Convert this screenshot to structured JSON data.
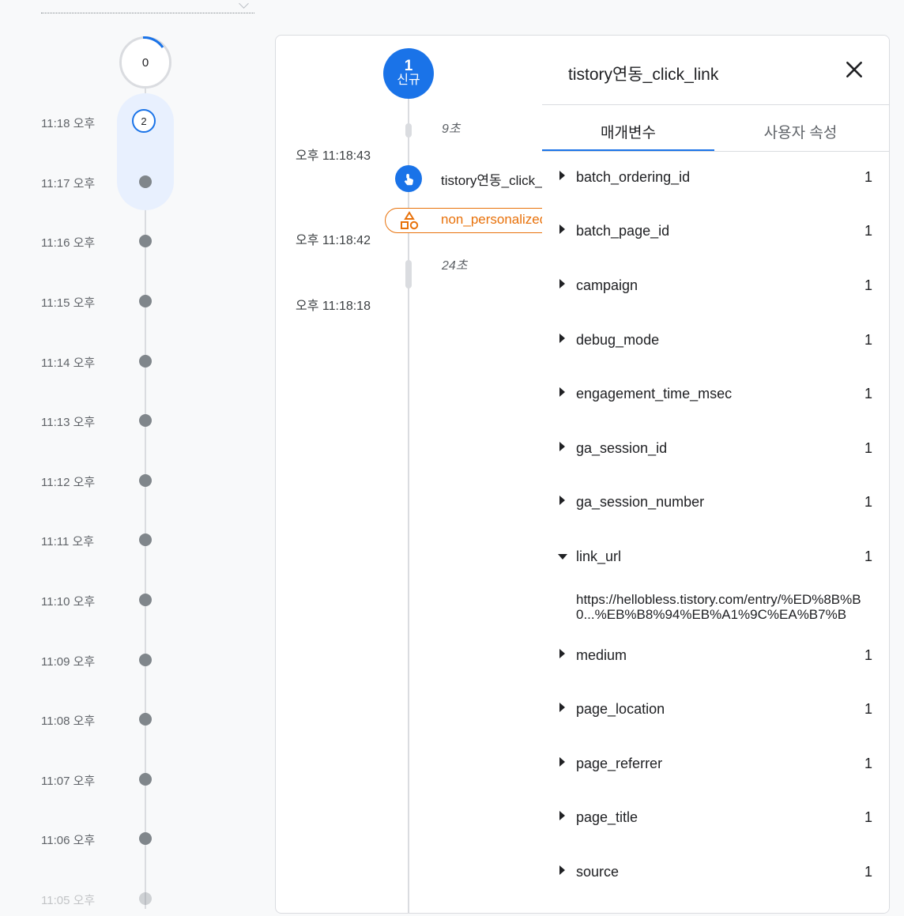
{
  "top_counter": "0",
  "selected_count": "2",
  "minutes": [
    "11:18 오후",
    "11:17 오후",
    "11:16 오후",
    "11:15 오후",
    "11:14 오후",
    "11:13 오후",
    "11:12 오후",
    "11:11 오후",
    "11:10 오후",
    "11:09 오후",
    "11:08 오후",
    "11:07 오후",
    "11:06 오후",
    "11:05 오후"
  ],
  "stream": {
    "badge_number": "1",
    "badge_label": "신규",
    "gaps": [
      "9초",
      "24초"
    ],
    "timestamps": [
      "오후 11:18:43",
      "오후 11:18:42",
      "오후 11:18:18"
    ],
    "event_label": "tistory연동_click_link",
    "np_label": "non_personalized_ads"
  },
  "drawer": {
    "title": "tistory연동_click_link",
    "tabs": [
      "매개변수",
      "사용자 속성"
    ],
    "params": [
      {
        "name": "batch_ordering_id",
        "count": "1"
      },
      {
        "name": "batch_page_id",
        "count": "1"
      },
      {
        "name": "campaign",
        "count": "1"
      },
      {
        "name": "debug_mode",
        "count": "1"
      },
      {
        "name": "engagement_time_msec",
        "count": "1"
      },
      {
        "name": "ga_session_id",
        "count": "1"
      },
      {
        "name": "ga_session_number",
        "count": "1"
      },
      {
        "name": "link_url",
        "count": "1",
        "expanded": true
      },
      {
        "name": "medium",
        "count": "1"
      },
      {
        "name": "page_location",
        "count": "1"
      },
      {
        "name": "page_referrer",
        "count": "1"
      },
      {
        "name": "page_title",
        "count": "1"
      },
      {
        "name": "source",
        "count": "1"
      }
    ],
    "link_url_value": "https://hellobless.tistory.com/entry/%ED%8B%B0...%EB%B8%94%EB%A1%9C%EA%B7%B"
  },
  "colors": {
    "accent": "#1a73e8",
    "warning": "#e8710a"
  }
}
